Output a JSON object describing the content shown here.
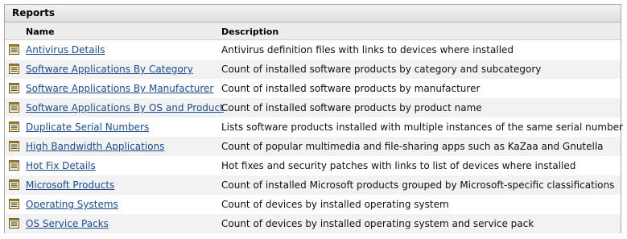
{
  "panel": {
    "title": "Reports",
    "columns": {
      "name": "Name",
      "description": "Description"
    }
  },
  "reports": [
    {
      "name": "Antivirus Details",
      "description": "Antivirus definition files with links to devices where installed",
      "icon": "report-icon"
    },
    {
      "name": "Software Applications By Category",
      "description": "Count of installed software products by category and subcategory",
      "icon": "report-icon"
    },
    {
      "name": "Software Applications By Manufacturer",
      "description": "Count of installed software products by manufacturer",
      "icon": "report-icon"
    },
    {
      "name": "Software Applications By OS and Product",
      "description": "Count of installed software products by product name",
      "icon": "report-icon"
    },
    {
      "name": "Duplicate Serial Numbers",
      "description": "Lists software products installed with multiple instances of the same serial number",
      "icon": "report-icon"
    },
    {
      "name": "High Bandwidth Applications",
      "description": "Count of popular multimedia and file-sharing apps such as KaZaa and Gnutella",
      "icon": "report-icon"
    },
    {
      "name": "Hot Fix Details",
      "description": "Hot fixes and security patches with links to list of devices where installed",
      "icon": "report-icon"
    },
    {
      "name": "Microsoft Products",
      "description": "Count of installed Microsoft products grouped by Microsoft-specific classifications",
      "icon": "report-icon"
    },
    {
      "name": "Operating Systems",
      "description": "Count of devices by installed operating system",
      "icon": "report-icon"
    },
    {
      "name": "OS Service Packs",
      "description": "Count of devices by installed operating system and service pack",
      "icon": "report-icon"
    }
  ],
  "colors": {
    "link": "#1b4b8f",
    "alt_row": "#f2f2f2",
    "header_bg": "#ededed"
  }
}
